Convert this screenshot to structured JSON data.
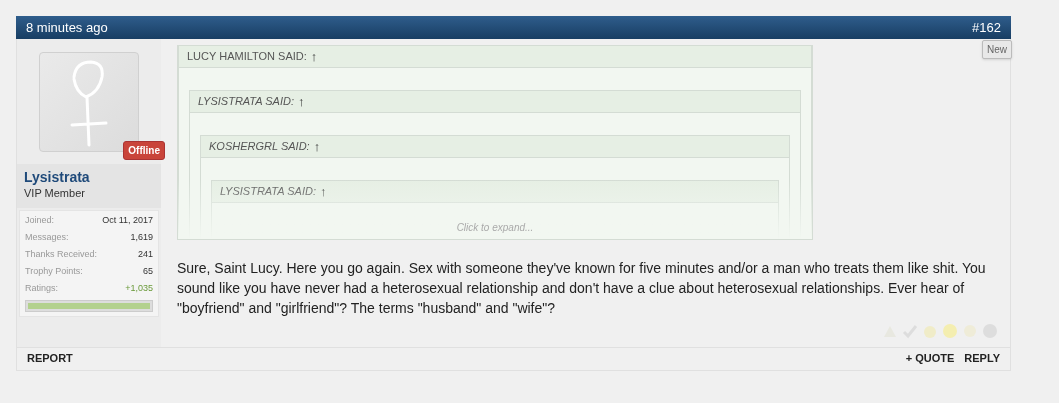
{
  "post": {
    "time": "8 minutes ago",
    "number": "#162",
    "badge": "New"
  },
  "author": {
    "name": "Lysistrata",
    "title": "VIP Member",
    "status": "Offline",
    "stats": [
      {
        "label": "Joined:",
        "value": "Oct 11, 2017",
        "kind": "plain"
      },
      {
        "label": "Messages:",
        "value": "1,619",
        "kind": "plain"
      },
      {
        "label": "Thanks Received:",
        "value": "241",
        "kind": "plain"
      },
      {
        "label": "Trophy Points:",
        "value": "65",
        "kind": "plain"
      },
      {
        "label": "Ratings:",
        "value": "+1,035",
        "kind": "positive"
      }
    ],
    "rating_bar": {
      "level": 1
    }
  },
  "quote": {
    "author": "LUCY HAMILTON SAID:",
    "arrow": "↑",
    "italic": false,
    "expand": "Click to expand...",
    "children": [
      {
        "author": "LYSISTRATA SAID:",
        "arrow": "↑",
        "italic": true,
        "children": [
          {
            "author": "KOSHERGRL SAID:",
            "arrow": "↑",
            "italic": true,
            "children": [
              {
                "author": "LYSISTRATA SAID:",
                "arrow": "↑",
                "italic": true
              }
            ]
          }
        ]
      }
    ]
  },
  "message": "Sure, Saint Lucy. Here you go again. Sex with someone they've known for five minutes and/or a man who treats them like shit. You sound like you have never had a heterosexual relationship and don't have a clue about heterosexual relationships. Ever hear of \"boyfriend\" and \"girlfriend\"? The terms \"husband\" and \"wife\"?",
  "footer": {
    "left": [
      "REPORT"
    ],
    "right": [
      "+ QUOTE",
      "REPLY"
    ]
  }
}
